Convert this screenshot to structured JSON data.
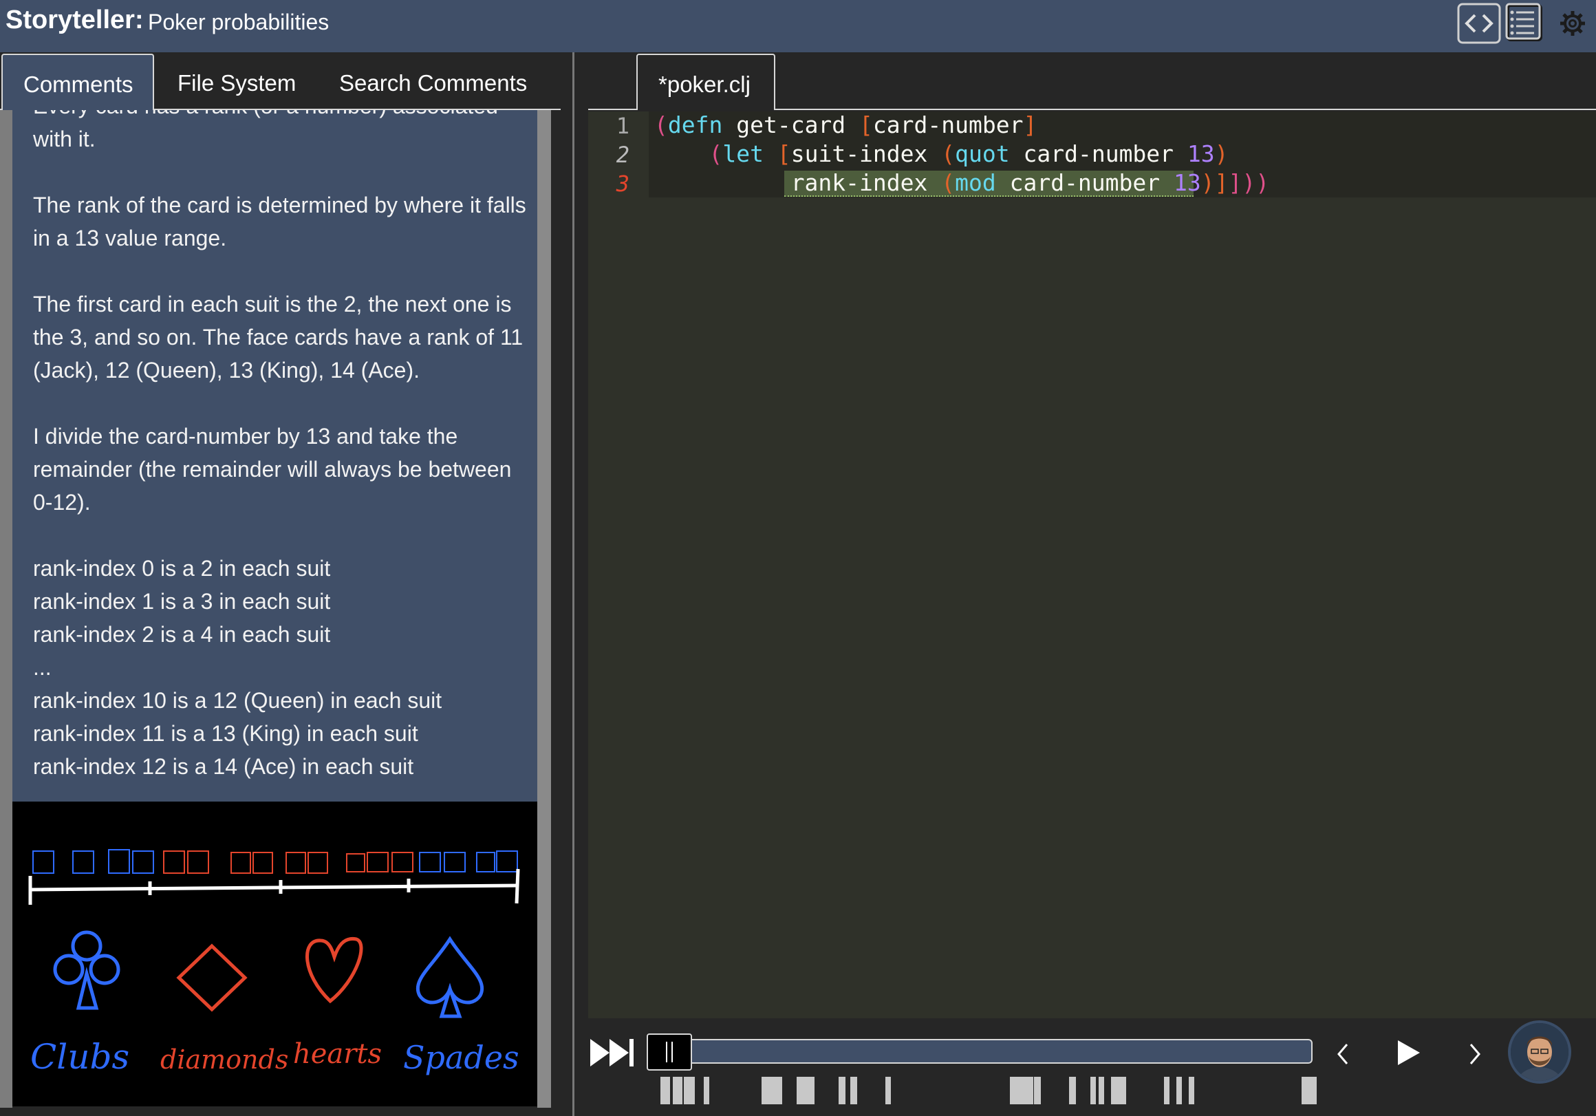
{
  "app": {
    "name": "Storyteller:",
    "document_title": "Poker probabilities"
  },
  "toolbar": {
    "icons": [
      "code-view-icon",
      "comment-list-icon",
      "settings-gear-icon"
    ]
  },
  "left_panel": {
    "tabs": [
      {
        "label": "Comments",
        "active": true
      },
      {
        "label": "File System",
        "active": false
      },
      {
        "label": "Search Comments",
        "active": false
      }
    ],
    "comment": {
      "cut_off_line": "Every card has a rank (or a number) associated",
      "paragraphs": [
        "with it.",
        "The rank of the card is determined by where it falls in a 13 value range.",
        "The first card in each suit is the 2, the next one is the 3, and so on. The face cards have a rank of 11 (Jack), 12 (Queen), 13 (King), 14 (Ace).",
        "I divide the card-number by 13 and take the remainder (the remainder will always be between 0-12)."
      ],
      "rank_lines": [
        "rank-index 0 is a 2 in each suit",
        "rank-index 1 is a 3 in each suit",
        "rank-index 2 is a 4 in each suit",
        "...",
        "rank-index 10 is a 12 (Queen) in each suit",
        "rank-index 11 is a 13 (King) in each suit",
        "rank-index 12 is a 14 (Ace) in each suit"
      ]
    },
    "drawing": {
      "suit_labels": [
        "Clubs",
        "diamonds",
        "hearts",
        "Spades"
      ],
      "colors": {
        "blue": "#2f6bff",
        "red": "#e5452c"
      }
    }
  },
  "editor": {
    "file_tab": "*poker.clj",
    "line_numbers": [
      "1",
      "2",
      "3"
    ],
    "lines": [
      {
        "indent": "",
        "tokens": [
          {
            "t": "(",
            "c": "p-pink"
          },
          {
            "t": "defn",
            "c": "kw"
          },
          {
            "t": " get-card ",
            "c": ""
          },
          {
            "t": "[",
            "c": "p-orange"
          },
          {
            "t": "card-number",
            "c": ""
          },
          {
            "t": "]",
            "c": "p-orange"
          }
        ]
      },
      {
        "indent": "    ",
        "tokens": [
          {
            "t": "(",
            "c": "p-pink"
          },
          {
            "t": "let",
            "c": "kw"
          },
          {
            "t": " ",
            "c": ""
          },
          {
            "t": "[",
            "c": "p-orange"
          },
          {
            "t": "suit-index ",
            "c": ""
          },
          {
            "t": "(",
            "c": "p-orange"
          },
          {
            "t": "quot",
            "c": "kw"
          },
          {
            "t": " card-number ",
            "c": ""
          },
          {
            "t": "13",
            "c": "num"
          },
          {
            "t": ")",
            "c": "p-orange"
          }
        ]
      },
      {
        "indent": "          ",
        "tokens": [
          {
            "t": "rank-index ",
            "c": ""
          },
          {
            "t": "(",
            "c": "p-orange"
          },
          {
            "t": "mod",
            "c": "kw"
          },
          {
            "t": " card-number ",
            "c": ""
          },
          {
            "t": "13",
            "c": "num"
          },
          {
            "t": ")",
            "c": "p-orange"
          },
          {
            "t": "]",
            "c": "p-orange"
          },
          {
            "t": "]",
            "c": "p-pink"
          },
          {
            "t": "))",
            "c": "p-pink"
          }
        ]
      }
    ]
  },
  "playback": {
    "controls": [
      "skip-to-end-icon",
      "pause-handle",
      "previous-icon",
      "play-icon",
      "next-icon"
    ]
  }
}
